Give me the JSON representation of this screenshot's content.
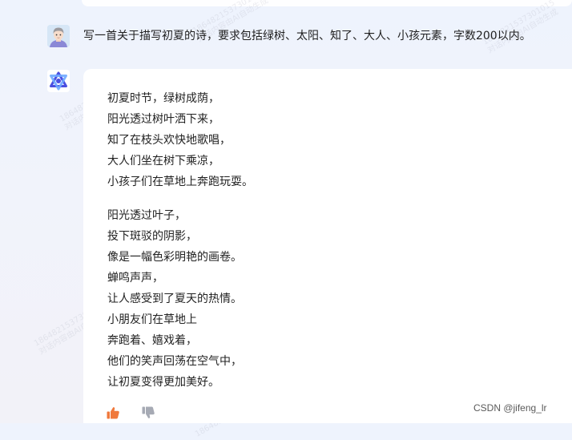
{
  "user_message": {
    "avatar": "user-avatar-icon",
    "text": "写一首关于描写初夏的诗，要求包括绿树、太阳、知了、大人、小孩元素，字数200以内。"
  },
  "bot": {
    "avatar": "assistant-logo-icon",
    "poem": {
      "stanza1": [
        "初夏时节，绿树成荫，",
        "阳光透过树叶洒下来，",
        "知了在枝头欢快地歌唱，",
        "大人们坐在树下乘凉，",
        "小孩子们在草地上奔跑玩耍。"
      ],
      "stanza2": [
        "阳光透过叶子，",
        "投下斑驳的阴影，",
        "像是一幅色彩明艳的画卷。",
        "蝉鸣声声，",
        "让人感受到了夏天的热情。",
        "小朋友们在草地上",
        "奔跑着、嬉戏着，",
        "他们的笑声回荡在空气中，",
        "让初夏变得更加美好。"
      ]
    },
    "feedback": {
      "like_icon": "thumbs-up-icon",
      "dislike_icon": "thumbs-down-icon",
      "like_color": "#f0793c",
      "dislike_color": "#a6aab4"
    }
  },
  "watermark": {
    "line1": "18648215373010​15",
    "line2": "对话内容由AI自动生成"
  },
  "credit": "CSDN @jifeng_lr"
}
